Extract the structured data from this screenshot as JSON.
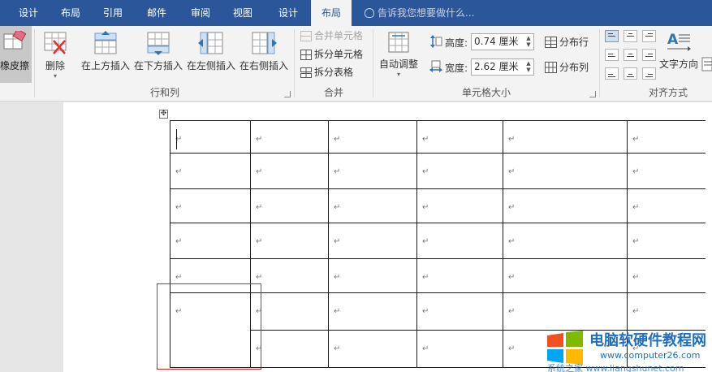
{
  "tabs": [
    {
      "label": "设计",
      "active": false
    },
    {
      "label": "布局",
      "active": false
    },
    {
      "label": "引用",
      "active": false
    },
    {
      "label": "邮件",
      "active": false
    },
    {
      "label": "审阅",
      "active": false
    },
    {
      "label": "视图",
      "active": false
    },
    {
      "label": "设计",
      "active": false
    },
    {
      "label": "布局",
      "active": true
    }
  ],
  "tell_me": "告诉我您想要做什么...",
  "ribbon": {
    "eraser": "橡皮擦",
    "delete": "删除",
    "insert_above": "在上方插入",
    "insert_below": "在下方插入",
    "insert_left": "在左侧插入",
    "insert_right": "在右侧插入",
    "group_rows_cols": "行和列",
    "merge_cells": "合并单元格",
    "split_cells": "拆分单元格",
    "split_table": "拆分表格",
    "group_merge": "合并",
    "autofit": "自动调整",
    "height_label": "高度:",
    "height_value": "0.74 厘米",
    "width_label": "宽度:",
    "width_value": "2.62 厘米",
    "distribute_rows": "分布行",
    "distribute_cols": "分布列",
    "group_cell_size": "单元格大小",
    "text_direction": "文字方向",
    "group_alignment": "对齐方式"
  },
  "document": {
    "paragraph_mark": "↵",
    "move_handle": "✥"
  },
  "watermark": {
    "title": "电脑软硬件教程网",
    "url": "www.computer26.com",
    "url2": "系统之家  www.liangshunet.com"
  },
  "colors": {
    "tab_bar": "#2b579a",
    "ribbon": "#f3f3f3",
    "highlight_box": "#e02020",
    "watermark_blue": "#1f6fc0"
  }
}
